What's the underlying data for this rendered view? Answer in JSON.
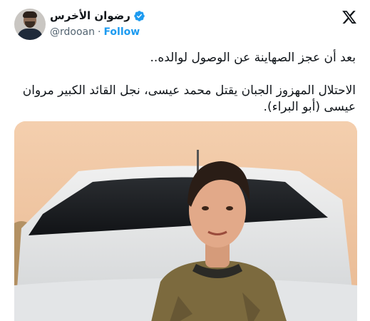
{
  "header": {
    "display_name": "رضوان الأخرس",
    "handle": "@rdooan",
    "separator": "·",
    "follow_label": "Follow",
    "verified_color": "#1d9bf0",
    "avatar_icon": "user-avatar",
    "brand_icon": "x-logo-icon"
  },
  "tweet": {
    "line1": "بعد أن عجز الصهاينة عن الوصول لوالده..",
    "line2": "الاحتلال المهزوز الجبان يقتل محمد عيسى، نجل القائد الكبير مروان عيسى (أبو البراء)."
  },
  "media": {
    "kind": "photo"
  },
  "colors": {
    "text": "#0f1419",
    "secondary": "#536471",
    "accent": "#1d9bf0"
  }
}
